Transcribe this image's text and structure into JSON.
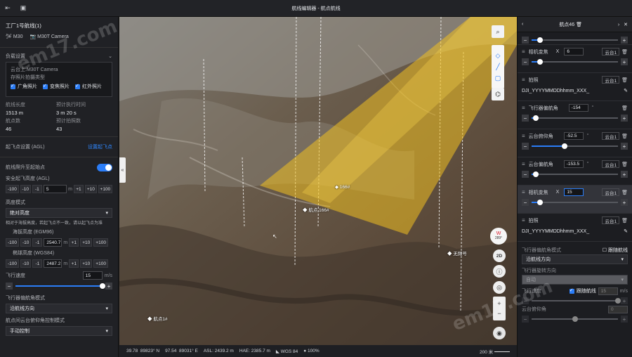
{
  "window": {
    "title": "航线编辑器 - 航点航线"
  },
  "left": {
    "drone": {
      "name": "工厂1号航线(1)",
      "model": "M30",
      "camera": "M30T Camera"
    },
    "payload": {
      "title": "负载设置",
      "camera_line": "云台上:M30T Camera",
      "lens_label": "存照片拍摄类型",
      "checks": [
        "广角照片",
        "变焦照片",
        "红外照片"
      ]
    },
    "stats": {
      "dist_label": "航线长度",
      "dist_value": "1513 m",
      "time_label": "预计执行时间",
      "time_value": "3 m 20 s",
      "wp_label": "航点数",
      "wp_value": "46",
      "photo_label": "预计拍照数",
      "photo_value": "43"
    },
    "takeoff": {
      "label": "起飞点设置 (AGL)",
      "link": "设置起飞点"
    },
    "climb": {
      "label": "航线爬升至起始点",
      "safe_label": "安全起飞高度 (AGL)",
      "value": "5",
      "unit": "m"
    },
    "stepper": {
      "m100": "-100",
      "m10": "-10",
      "m1": "-1",
      "p1": "+1",
      "p10": "+10",
      "p100": "+100"
    },
    "altitude": {
      "mode_label": "高度模式",
      "mode_value": "绝对高度",
      "hint": "相对于海拔高度，若起飞点不一致，请以起飞点为准",
      "egm_label": "海拔高度 (EGM96)",
      "egm_value": "2540.7",
      "wgs_label": "椭球高度 (WGS84)",
      "wgs_value": "2487.2",
      "unit": "m"
    },
    "speed": {
      "label": "飞行速度",
      "value": "15",
      "unit": "m/s",
      "fraction": 1.0
    },
    "yaw": {
      "label": "飞行器偏航角模式",
      "value": "沿航线方向"
    },
    "gimbal": {
      "label": "航点间云台俯仰角控制模式",
      "value": "手动控制"
    }
  },
  "map": {
    "markers": [
      {
        "label": "166#",
        "mx": ""
      },
      {
        "label": "航点 166#"
      },
      {
        "label": "无频号"
      },
      {
        "label": "航点1#"
      }
    ],
    "compass": {
      "dir": "W",
      "deg": "289°"
    },
    "btn_2d": "2D",
    "zoom_in": "+",
    "zoom_out": "−"
  },
  "status": {
    "lat": "39.78",
    "lat_frac": "89823° N",
    "lon": "97.54",
    "lon_frac": "89031° E",
    "asl": "ASL: 2439.2 m",
    "hae": "HAE: 2385.7 m",
    "datum": "WGS 84",
    "zoom": "100%",
    "scale": "200 米"
  },
  "right": {
    "header": {
      "title": "航点46"
    },
    "actions": [
      {
        "type": "slider",
        "knob": 0.1
      },
      {
        "label": "相机变焦",
        "x": "X",
        "value": "6",
        "tag": "云台1",
        "knob": 0.1
      },
      {
        "label": "拍照",
        "tag": "云台1",
        "file": "DJI_YYYYMMDDhhmm_XXX_"
      },
      {
        "label": "飞行器偏航角",
        "value": "-154",
        "deg": "°",
        "knob": 0.05
      },
      {
        "label": "云台俯仰角",
        "value": "-52.5",
        "deg": "°",
        "tag": "云台1",
        "knob": 0.38
      },
      {
        "label": "云台偏航角",
        "value": "-153.5",
        "deg": "°",
        "tag": "云台1",
        "knob": 0.05
      },
      {
        "label": "相机变焦",
        "x": "X",
        "value": "15",
        "tag": "云台1",
        "knob": 0.1,
        "selected": true
      },
      {
        "label": "拍照",
        "tag": "云台1",
        "file": "DJI_YYYYMMDDhhmm_XXX_"
      }
    ],
    "yaw_mode": {
      "label": "飞行器偏航角模式",
      "follow": "跟随航线",
      "value": "沿航线方向"
    },
    "rotate": {
      "label": "飞行器旋转方向",
      "value": "自动"
    },
    "speed": {
      "label": "飞行速度",
      "follow": "跟随航线",
      "value": "15",
      "unit": "m/s"
    },
    "pitch": {
      "label": "云台俯仰角",
      "value": "0"
    }
  },
  "watermark": "em17.com",
  "colors": {
    "accent": "#2b7df7",
    "route": "#f0c020"
  }
}
